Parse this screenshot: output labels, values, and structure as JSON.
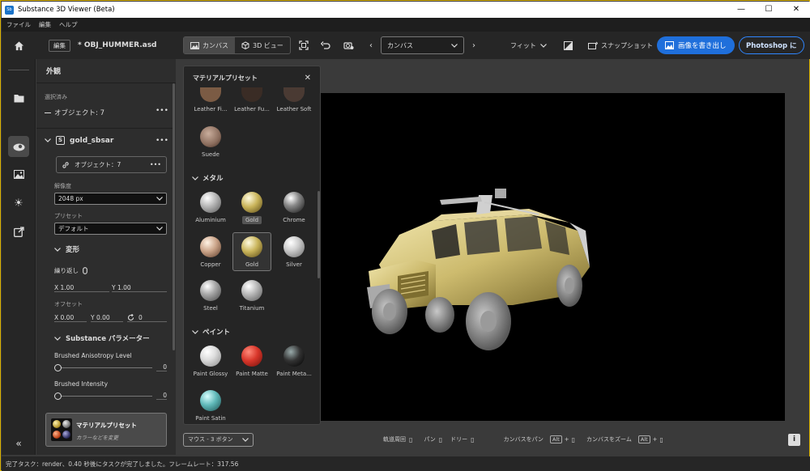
{
  "window": {
    "title": "Substance 3D Viewer (Beta)"
  },
  "menu": [
    "ファイル",
    "編集",
    "ヘルプ"
  ],
  "toolbar": {
    "edit_label": "編集",
    "filename": "* OBJ_HUMMER.asd",
    "canvas_tab": "カンバス",
    "view3d_tab": "3D ビュー",
    "canvas_dropdown": "カンバス",
    "fit_label": "フィット",
    "snapshot_label": "スナップショット",
    "export_label": "画像を書き出し",
    "photoshop_label": "Photoshop に"
  },
  "panel": {
    "header": "外観",
    "selected_label": "選択済み",
    "objects_label": "オブジェクト: 7",
    "material_name": "gold_sbsar",
    "material_objects": "オブジェクト：7",
    "resolution_label": "解像度",
    "resolution_value": "2048 px",
    "preset_label": "プリセット",
    "preset_value": "デフォルト",
    "transform_label": "変形",
    "repeat_label": "繰り返し",
    "x_repeat": "X 1.00",
    "y_repeat": "Y 1.00",
    "offset_label": "オフセット",
    "x_offset": "X 0.00",
    "y_offset": "Y 0.00",
    "rotation": "0",
    "substance_params_label": "Substance パラメーター",
    "param1_label": "Brushed Anisotropy Level",
    "param1_value": "0",
    "param1_level": 0,
    "param2_label": "Brushed Intensity",
    "param2_value": "0",
    "param2_level": 0,
    "preset_card_title": "マテリアルプリセット",
    "preset_card_sub": "カラーなどを変更"
  },
  "popup": {
    "title": "マテリアルプリセット",
    "leather": [
      "Leather Fi...",
      "Leather Fu...",
      "Leather Soft"
    ],
    "suede": "Suede",
    "metal_header": "メタル",
    "metals": [
      "Aluminium",
      "Gold",
      "Chrome",
      "Copper",
      "Gold",
      "Silver",
      "Steel",
      "Titanium"
    ],
    "tooltip": "Gold",
    "paint_header": "ペイント",
    "paints": [
      "Paint Glossy",
      "Paint Matte",
      "Paint Meta...",
      "Paint Satin"
    ]
  },
  "bottom": {
    "mouse_mode": "マウス - 3 ボタン",
    "orbit": "軌道周回",
    "pan": "パン",
    "dolly": "ドリー",
    "canvas_pan": "カンバスをパン",
    "canvas_zoom": "カンバスをズーム",
    "alt": "Alt",
    "plus1": "+",
    "plus2": "+"
  },
  "status": "完了タスク：render、0.40 秒後にタスクが完了しました。フレームレート：317.56"
}
